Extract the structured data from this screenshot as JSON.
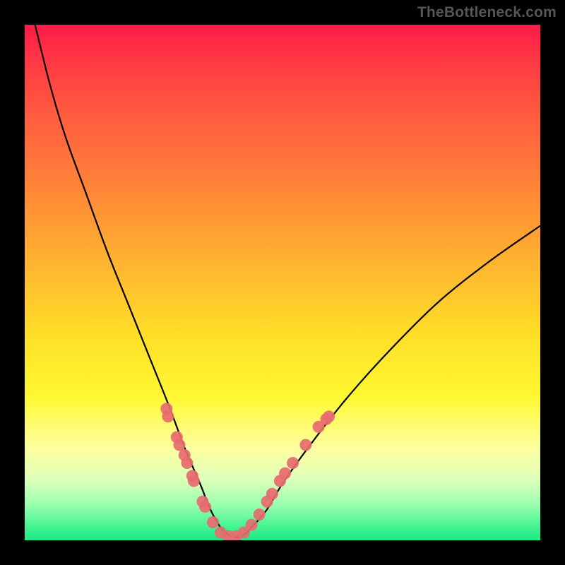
{
  "watermark": "TheBottleneck.com",
  "colors": {
    "curve": "#000000",
    "dot": "#e76b6f",
    "frame": "#000000"
  },
  "chart_data": {
    "type": "line",
    "title": "",
    "xlabel": "",
    "ylabel": "",
    "xlim": [
      0,
      100
    ],
    "ylim": [
      0,
      100
    ],
    "note": "Axes are unlabeled; x/y values are estimated pixel-space positions normalized to 0–100. Curve shows a sharp funnel/V shape dipping to ~0 near x≈40 with scattered data markers near the base.",
    "series": [
      {
        "name": "curve",
        "x": [
          2,
          5,
          8,
          12,
          16,
          20,
          24,
          28,
          31,
          34,
          36,
          38,
          40,
          42,
          44,
          47,
          50,
          55,
          62,
          70,
          80,
          90,
          100
        ],
        "y": [
          100,
          88,
          78,
          67,
          56,
          46,
          36,
          26,
          18,
          11,
          6,
          2.5,
          0.8,
          0.8,
          2.5,
          6,
          11,
          18,
          27,
          36,
          46,
          54,
          61
        ]
      }
    ],
    "scatter": {
      "name": "data-points",
      "points": [
        {
          "x": 27.5,
          "y": 25.5
        },
        {
          "x": 27.8,
          "y": 24.0
        },
        {
          "x": 29.5,
          "y": 20.0
        },
        {
          "x": 30.0,
          "y": 18.5
        },
        {
          "x": 31.0,
          "y": 16.5
        },
        {
          "x": 31.5,
          "y": 15.0
        },
        {
          "x": 32.5,
          "y": 12.5
        },
        {
          "x": 32.8,
          "y": 11.5
        },
        {
          "x": 34.5,
          "y": 7.5
        },
        {
          "x": 35.0,
          "y": 6.5
        },
        {
          "x": 36.5,
          "y": 3.5
        },
        {
          "x": 38.0,
          "y": 1.5
        },
        {
          "x": 39.5,
          "y": 0.8
        },
        {
          "x": 41.0,
          "y": 0.8
        },
        {
          "x": 42.5,
          "y": 1.5
        },
        {
          "x": 44.0,
          "y": 3.0
        },
        {
          "x": 45.5,
          "y": 5.0
        },
        {
          "x": 47.0,
          "y": 7.5
        },
        {
          "x": 48.0,
          "y": 9.0
        },
        {
          "x": 49.5,
          "y": 11.5
        },
        {
          "x": 50.5,
          "y": 13.0
        },
        {
          "x": 52.0,
          "y": 15.0
        },
        {
          "x": 54.5,
          "y": 18.5
        },
        {
          "x": 57.0,
          "y": 22.0
        },
        {
          "x": 58.5,
          "y": 23.5
        },
        {
          "x": 59.0,
          "y": 24.0
        }
      ]
    }
  }
}
